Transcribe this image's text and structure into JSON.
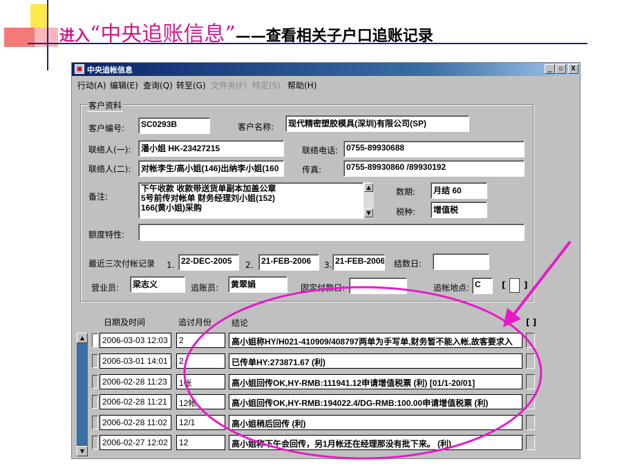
{
  "slide": {
    "title_prefix": "进入",
    "title_name": "“中央追账信息”",
    "title_suffix": "——查看相关子户口追账记录"
  },
  "window": {
    "title": "中央追帐信息",
    "minimize": "_",
    "restore": "▫",
    "close": "X"
  },
  "menu": {
    "items": [
      {
        "label": "行动(A)",
        "enabled": true
      },
      {
        "label": "编辑(E)",
        "enabled": true
      },
      {
        "label": "查询(Q)",
        "enabled": true
      },
      {
        "label": "转至(G)",
        "enabled": true
      },
      {
        "label": "文件夹(F)",
        "enabled": false
      },
      {
        "label": "特定(S)",
        "enabled": false
      },
      {
        "label": "帮助(H)",
        "enabled": true
      }
    ]
  },
  "customer": {
    "group_title": "客户资料",
    "code_label": "客户编号:",
    "code": "SC0293B",
    "name_label": "客户名称:",
    "name": "现代精密塑胶模具(深圳)有限公司(SP)",
    "contact1_label": "联络人(一):",
    "contact1": "潘小姐          HK-23427215",
    "phone_label": "联络电话:",
    "phone": "0755-89930688",
    "contact2_label": "联络人(二):",
    "contact2": "对帐李生/高小姐(146)出纳李小姐(160",
    "fax_label": "传真:",
    "fax": "0755-89930860 /89930192",
    "remarks_label": "备注:",
    "remarks_lines": [
      "下午收款 收款带送货单副本加盖公章",
      "5号前传对帐单 财务经理刘小姐(152)",
      "166(黄小姐)采购"
    ],
    "term_label": "数期:",
    "term": "月结 60",
    "tax_label": "税种:",
    "tax": "增值税",
    "credit_label": "额度特性:",
    "credit": "",
    "last3_label": "最近三次付帐记录",
    "pay1_no": "1.",
    "pay1": "22-DEC-2005",
    "pay2_no": "2.",
    "pay2": "21-FEB-2006",
    "pay3_no": "3.",
    "pay3": "21-FEB-2006",
    "close_day_label": "结数日:",
    "close_day": "",
    "sales_label": "营业员:",
    "sales": "梁志义",
    "collector_label": "追账员:",
    "collector": "黄翠娟",
    "fixed_day_label": "固定付款日:",
    "fixed_day": "",
    "location_label": "追帐地点:",
    "location": "C",
    "bracket_open": "[",
    "bracket_close": "]"
  },
  "grid": {
    "col_datetime": "日期及时间",
    "col_month": "追讨月份",
    "col_result": "结论",
    "col_flag": "[ ]",
    "rows": [
      {
        "datetime": "2006-03-03 12:03",
        "month": "2",
        "result": "高小姐称HY/H021-410909/408797两单为手写单,财务暂不能入帐,故客要求入"
      },
      {
        "datetime": "2006-03-01 14:01",
        "month": "2",
        "result": "已传单HY:273871.67  (利)"
      },
      {
        "datetime": "2006-02-28 11:23",
        "month": "1帐",
        "result": "高小姐回传OK,HY-RMB:111941.12申请增值税票   (利)  [01/1-20/01]"
      },
      {
        "datetime": "2006-02-28 11:21",
        "month": "12帐",
        "result": "高小姐回传OK,HY-RMB:194022.4/DG-RMB:100.00申请增值税票    (利)"
      },
      {
        "datetime": "2006-02-28 11:02",
        "month": "12/1",
        "result": "高小姐稍后回传               (利)"
      },
      {
        "datetime": "2006-02-27 12:02",
        "month": "12",
        "result": "高小姐称下午会回传，另1月帐还在经理那没有批下来。       (利)"
      }
    ]
  },
  "colors": {
    "annotation": "#e619c8",
    "title_magenta": "#d4148a",
    "titlebar": "#0a246a"
  }
}
